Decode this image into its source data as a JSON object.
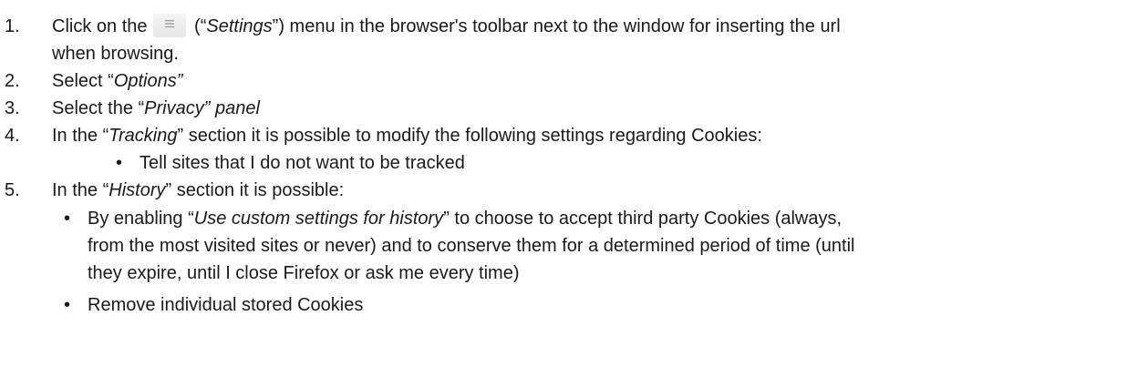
{
  "steps": [
    {
      "number": "1.",
      "before": "Click on the",
      "icon": "menu-icon",
      "after_open": " (“",
      "after_em": "Settings",
      "after_close": "”) menu in the browser's toolbar next to the window for inserting the url",
      "line2": "when browsing."
    },
    {
      "number": "2.",
      "before": "Select “",
      "em": "Options”"
    },
    {
      "number": "3.",
      "before": "Select the “",
      "em": "Privacy” panel"
    },
    {
      "number": "4.",
      "before": "In the “",
      "em": "Tracking",
      "after": "” section it is possible to modify the following settings regarding Cookies:",
      "bullets": [
        "Tell sites that I do not want to be tracked"
      ]
    },
    {
      "number": "5.",
      "before": "In the “",
      "em": "History",
      "after": "” section it is possible:",
      "bullets": [
        {
          "before": "By enabling “",
          "em": "Use custom settings for history",
          "after": "” to choose to accept third party Cookies (always,",
          "line2": "from the most visited sites or never) and to conserve them for a determined period of time (until",
          "line3": "they expire, until I close Firefox or ask me every time)"
        },
        "Remove individual stored Cookies"
      ]
    }
  ],
  "bullet_symbol": "•"
}
